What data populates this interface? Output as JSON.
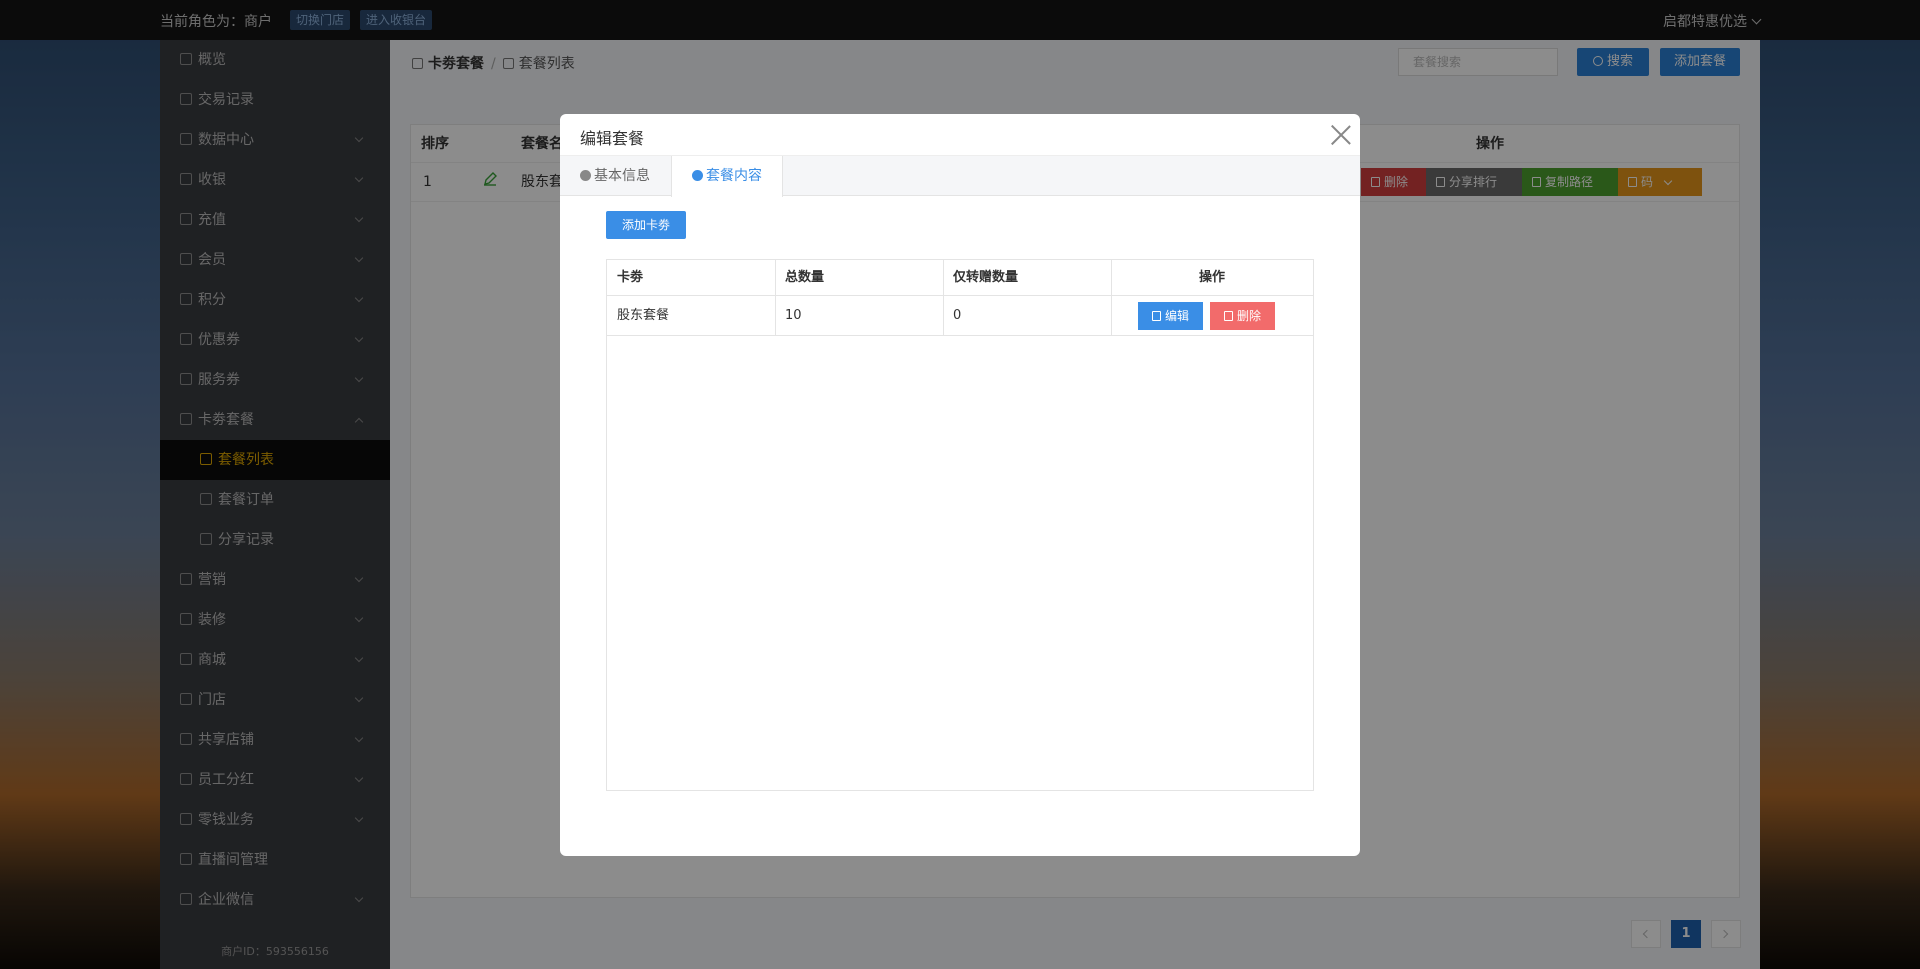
{
  "topbar": {
    "role_text": "当前角色为：商户",
    "switch_store": "切换门店",
    "enter_cashier": "进入收银台",
    "store_name": "启都特惠优选"
  },
  "sidebar": {
    "items": [
      {
        "label": "概览",
        "icon": "overview-icon",
        "has_arrow": false
      },
      {
        "label": "交易记录",
        "icon": "transaction-icon",
        "has_arrow": false
      },
      {
        "label": "数据中心",
        "icon": "data-center-icon",
        "has_arrow": true
      },
      {
        "label": "收银",
        "icon": "cashier-icon",
        "has_arrow": true
      },
      {
        "label": "充值",
        "icon": "recharge-icon",
        "has_arrow": true
      },
      {
        "label": "会员",
        "icon": "member-icon",
        "has_arrow": true
      },
      {
        "label": "积分",
        "icon": "points-icon",
        "has_arrow": true
      },
      {
        "label": "优惠券",
        "icon": "coupon-icon",
        "has_arrow": true
      },
      {
        "label": "服务券",
        "icon": "service-coupon-icon",
        "has_arrow": true
      },
      {
        "label": "卡劵套餐",
        "icon": "card-package-icon",
        "has_arrow": true,
        "expanded": true
      },
      {
        "label": "套餐列表",
        "icon": "package-list-icon",
        "sub": true,
        "active": true
      },
      {
        "label": "套餐订单",
        "icon": "package-order-icon",
        "sub": true
      },
      {
        "label": "分享记录",
        "icon": "share-record-icon",
        "sub": true
      },
      {
        "label": "营销",
        "icon": "marketing-icon",
        "has_arrow": true
      },
      {
        "label": "装修",
        "icon": "decoration-icon",
        "has_arrow": true
      },
      {
        "label": "商城",
        "icon": "mall-icon",
        "has_arrow": true
      },
      {
        "label": "门店",
        "icon": "store-icon",
        "has_arrow": true
      },
      {
        "label": "共享店铺",
        "icon": "shared-store-icon",
        "has_arrow": true
      },
      {
        "label": "员工分红",
        "icon": "staff-bonus-icon",
        "has_arrow": true
      },
      {
        "label": "零钱业务",
        "icon": "change-business-icon",
        "has_arrow": true
      },
      {
        "label": "直播间管理",
        "icon": "live-room-icon",
        "has_arrow": false
      },
      {
        "label": "企业微信",
        "icon": "wecom-icon",
        "has_arrow": true
      }
    ],
    "merchant_id": "商户ID：593556156"
  },
  "main": {
    "breadcrumb": [
      "卡劵套餐",
      "套餐列表"
    ],
    "search_placeholder": "套餐搜索",
    "search_label": "搜索",
    "add_package_label": "添加套餐",
    "table": {
      "headers": [
        "排序",
        "套餐名",
        "操作"
      ],
      "row": {
        "sort": "1",
        "name": "股东套"
      },
      "actions": [
        "删除",
        "分享排行",
        "复制路径",
        "码"
      ]
    },
    "pager": {
      "current": "1"
    }
  },
  "modal": {
    "title": "编辑套餐",
    "tabs": [
      "基本信息",
      "套餐内容"
    ],
    "active_tab": 1,
    "add_coupon_label": "添加卡劵",
    "table": {
      "headers": [
        "卡劵",
        "总数量",
        "仅转赠数量",
        "操作"
      ],
      "rows": [
        {
          "coupon": "股东套餐",
          "total": "10",
          "transfer_only": "0"
        }
      ],
      "edit_label": "编辑",
      "delete_label": "删除"
    }
  },
  "colors": {
    "primary_blue": "#3a8ee6",
    "danger_red": "#f26b6b",
    "active_gold": "#e0a800",
    "sidebar_bg": "#3a3c41"
  }
}
